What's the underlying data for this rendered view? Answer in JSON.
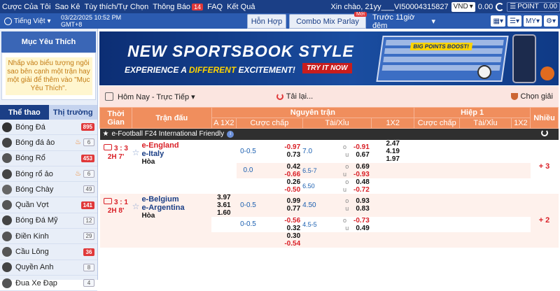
{
  "topnav": {
    "items": [
      "Cược Của Tôi",
      "Sao Kê",
      "Tùy thích/Tự Chọn",
      "Thông Báo",
      "FAQ",
      "Kết Quả"
    ],
    "notice_count": "14",
    "greeting": "Xin chào, 21yy___VI50004315827",
    "currency": "VND",
    "balance": "0.00",
    "point_label": "POINT",
    "point_value": "0.00"
  },
  "subbar": {
    "language": "Tiếng Việt",
    "datetime": "03/22/2025 10:52 PM GMT+8",
    "tabs": [
      "Hỗn Hợp",
      "Combo Mix Parlay",
      "Trước 11giờ đêm"
    ],
    "new_badge": "Mới",
    "my_label": "MY"
  },
  "sidebar": {
    "favorites_title": "Mục Yêu Thích",
    "favorites_hint": "Nhấp vào biểu tượng ngôi sao bên cạnh một trận hay một giải để thêm vào \"Mục Yêu Thích\".",
    "tabs": [
      "Thể thao",
      "Thị trường"
    ],
    "sports": [
      {
        "name": "Bóng Đá",
        "count": "895",
        "hot": false,
        "red": true
      },
      {
        "name": "Bóng đá ảo",
        "count": "6",
        "hot": true,
        "red": false
      },
      {
        "name": "Bóng Rổ",
        "count": "453",
        "hot": false,
        "red": true
      },
      {
        "name": "Bóng rổ ảo",
        "count": "6",
        "hot": true,
        "red": false
      },
      {
        "name": "Bóng Chày",
        "count": "49",
        "hot": false,
        "red": false
      },
      {
        "name": "Quần Vợt",
        "count": "141",
        "hot": false,
        "red": true
      },
      {
        "name": "Bóng Đá Mỹ",
        "count": "12",
        "hot": false,
        "red": false
      },
      {
        "name": "Điền Kinh",
        "count": "29",
        "hot": false,
        "red": false
      },
      {
        "name": "Cầu Lông",
        "count": "36",
        "hot": false,
        "red": true
      },
      {
        "name": "Quyền Anh",
        "count": "8",
        "hot": false,
        "red": false
      },
      {
        "name": "Đua Xe Đạp",
        "count": "4",
        "hot": false,
        "red": false
      }
    ]
  },
  "banner": {
    "title": "NEW SPORTSBOOK STYLE",
    "sub_pre": "EXPERIENCE A ",
    "sub_em": "DIFFERENT",
    "sub_post": " EXCITEMENT!",
    "cta": "TRY IT NOW",
    "boost": "BIG POINTS BOOST!"
  },
  "toolbar": {
    "filter": "Hôm Nay - Trực Tiếp",
    "retry": "Tải lại...",
    "pick": "Chọn giải"
  },
  "table": {
    "headers": {
      "time": "Thời Gian",
      "match": "Trận đấu",
      "full": "Nguyên trận",
      "half": "Hiệp 1",
      "more": "Nhiều",
      "a1x2": "A 1X2",
      "handicap": "Cược chấp",
      "ou": "Tài/Xỉu",
      "x12": "1X2",
      "h_handicap": "Cược chấp",
      "h_ou": "Tài/Xỉu",
      "h_x12": "1X2"
    },
    "league": "e-Football F24 International Friendly",
    "matches": [
      {
        "score": "3 : 3",
        "time": "2H 7'",
        "home": "e-England",
        "away": "e-Italy",
        "draw": "Hòa",
        "more": "+ 3",
        "rows": [
          {
            "hdp": "0-0.5",
            "hdp_h": "-0.97",
            "hdp_a": "0.73",
            "ou": "7.0",
            "ou_h": "-0.91",
            "ou_a": "0.67",
            "x1": "2.47",
            "xx": "4.19",
            "x2": "1.97"
          },
          {
            "hdp": "0.0",
            "hdp_h": "0.42",
            "hdp_a": "-0.66",
            "ou": "6.5-7",
            "ou_h": "0.69",
            "ou_a": "-0.93"
          },
          {
            "hdp": "",
            "hdp_h": "0.26",
            "hdp_a": "-0.50",
            "ou": "6.50",
            "ou_h": "0.48",
            "ou_a": "-0.72"
          }
        ]
      },
      {
        "score": "3 : 1",
        "time": "2H 8'",
        "home": "e-Belgium",
        "away": "e-Argentina",
        "draw": "Hòa",
        "more": "+ 2",
        "a1x2": [
          "3.97",
          "3.61",
          "1.60"
        ],
        "rows": [
          {
            "hdp": "0-0.5",
            "hdp_h": "0.99",
            "hdp_a": "0.77",
            "ou": "4.50",
            "ou_h": "0.93",
            "ou_a": "0.83"
          },
          {
            "hdp": "0-0.5",
            "hdp_h": "-0.56",
            "hdp_a": "0.32",
            "ou": "4.5-5",
            "ou_h": "-0.73",
            "ou_a": "0.49"
          },
          {
            "hdp": "",
            "hdp_h": "0.30",
            "hdp_a": "-0.54",
            "ou": "",
            "ou_h": "",
            "ou_a": ""
          }
        ]
      }
    ]
  }
}
